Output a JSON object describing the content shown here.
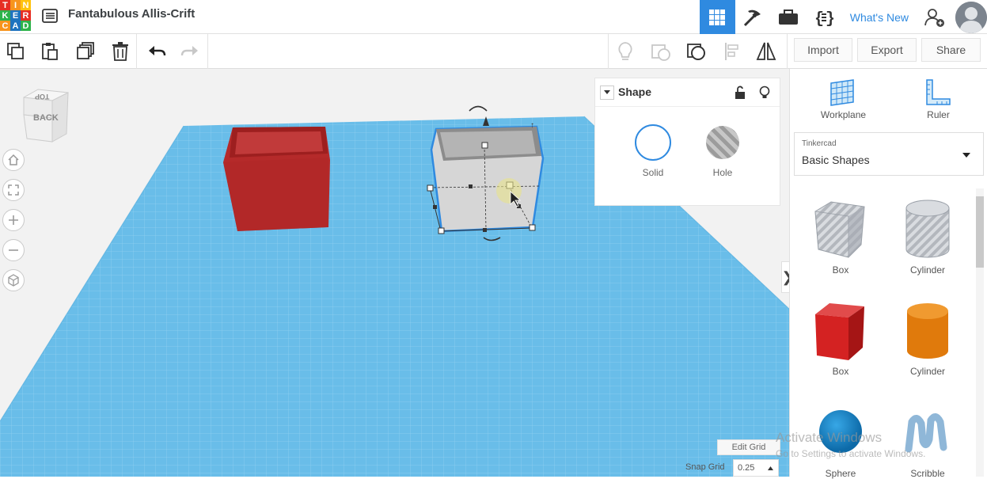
{
  "logo": {
    "letters": [
      "T",
      "I",
      "N",
      "K",
      "E",
      "R",
      "C",
      "A",
      "D"
    ],
    "colors": [
      "#e62e24",
      "#f7941d",
      "#ffc20e",
      "#2db34a",
      "#1e73be",
      "#e62e24",
      "#f7941d",
      "#1e73be",
      "#2db34a"
    ]
  },
  "header": {
    "title": "Fantabulous Allis-Crift",
    "whats_new": "What's New"
  },
  "toolbar": {
    "import": "Import",
    "export": "Export",
    "share": "Share"
  },
  "viewcube": {
    "top": "TOP",
    "back": "BACK"
  },
  "shape_panel": {
    "title": "Shape",
    "solid": "Solid",
    "hole": "Hole"
  },
  "right_panel": {
    "workplane": "Workplane",
    "ruler": "Ruler",
    "library_group": "Tinkercad",
    "library_name": "Basic Shapes",
    "shapes": [
      {
        "label": "Box"
      },
      {
        "label": "Cylinder"
      },
      {
        "label": "Box"
      },
      {
        "label": "Cylinder"
      },
      {
        "label": "Sphere"
      },
      {
        "label": "Scribble"
      }
    ]
  },
  "grid": {
    "edit_grid": "Edit Grid",
    "snap_label": "Snap Grid",
    "snap_value": "0.25"
  },
  "watermark": {
    "line1": "Activate Windows",
    "line2": "Go to Settings to activate Windows."
  },
  "colors": {
    "accent": "#2f8ae0",
    "grid": "#5eb7e8",
    "red_box": "#b52a2a"
  }
}
